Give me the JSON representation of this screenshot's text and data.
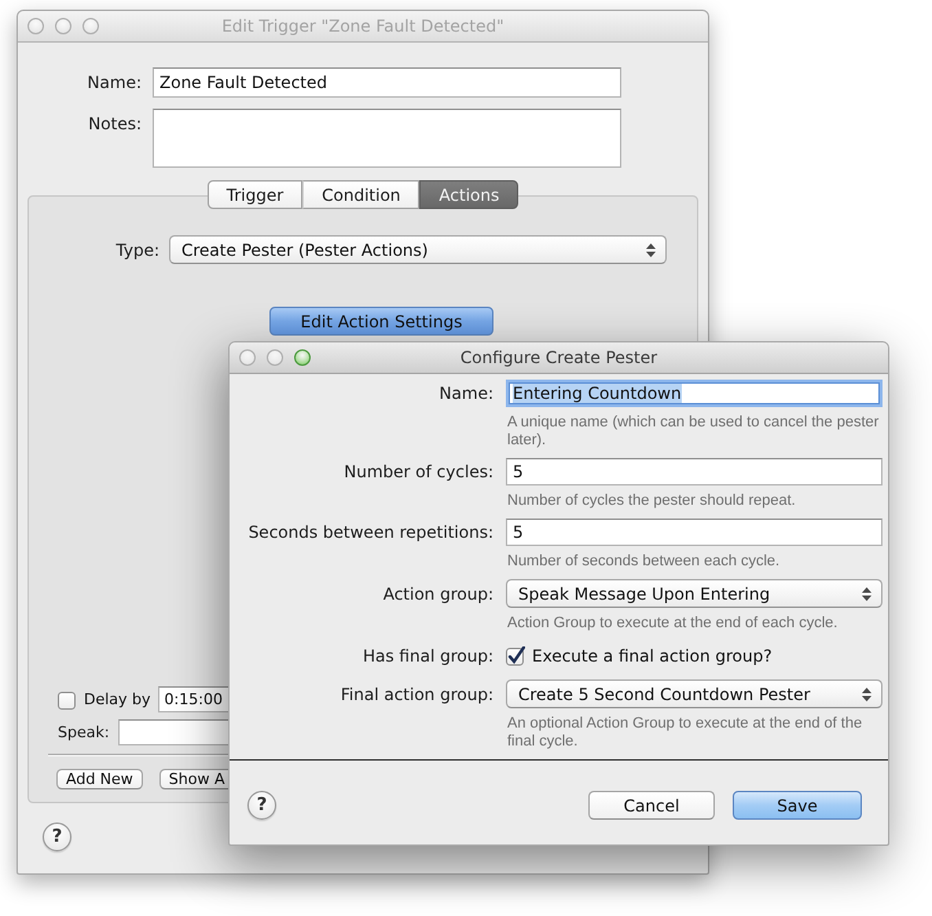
{
  "back_window": {
    "title": "Edit Trigger \"Zone Fault Detected\"",
    "active": false,
    "window_buttons": [
      {
        "enabled": false
      },
      {
        "enabled": false
      },
      {
        "enabled": false
      }
    ],
    "name": {
      "label": "Name:",
      "value": "Zone Fault Detected"
    },
    "notes": {
      "label": "Notes:"
    },
    "tabs": [
      {
        "label": "Trigger",
        "selected": false
      },
      {
        "label": "Condition",
        "selected": false
      },
      {
        "label": "Actions",
        "selected": true
      }
    ],
    "type": {
      "label": "Type:",
      "value": "Create Pester (Pester Actions)"
    },
    "edit_button": {
      "label": "Edit Action Settings",
      "default": true
    },
    "delay": {
      "label": "Delay by",
      "checked": false,
      "value": "0:15:00"
    },
    "speak": {
      "label": "Speak:"
    },
    "buttons": [
      {
        "label": "Add New",
        "default": false
      },
      {
        "label": "Show A",
        "default": false
      }
    ],
    "help_button": "?"
  },
  "dialog": {
    "title": "Configure Create Pester",
    "active": true,
    "window_buttons": [
      {
        "enabled": false
      },
      {
        "enabled": false
      },
      {
        "enabled": true
      }
    ],
    "rows": [
      {
        "kind": "field",
        "label": "Name:",
        "value": "Entering Countdown",
        "focused": true,
        "text_selected": true,
        "hint": "A unique name (which can be used to cancel the pester later)."
      },
      {
        "kind": "field",
        "label": "Number of cycles:",
        "value": "5",
        "focused": false,
        "text_selected": false,
        "hint": "Number of cycles the pester should repeat."
      },
      {
        "kind": "field",
        "label": "Seconds between repetitions:",
        "value": "5",
        "focused": false,
        "text_selected": false,
        "hint": "Number of seconds between each cycle."
      },
      {
        "kind": "popup",
        "label": "Action group:",
        "value": "Speak Message Upon Entering",
        "hint": "Action Group to execute at the end of each cycle."
      },
      {
        "kind": "checkbox",
        "label": "Has final group:",
        "text": "Execute a final action group?",
        "checked": true
      },
      {
        "kind": "popup",
        "label": "Final action group:",
        "value": "Create 5 Second Countdown Pester",
        "hint": "An optional Action Group to execute at the end of the final cycle."
      }
    ],
    "help_button": "?",
    "buttons": [
      {
        "label": "Cancel",
        "default": false
      },
      {
        "label": "Save",
        "default": true
      }
    ]
  }
}
